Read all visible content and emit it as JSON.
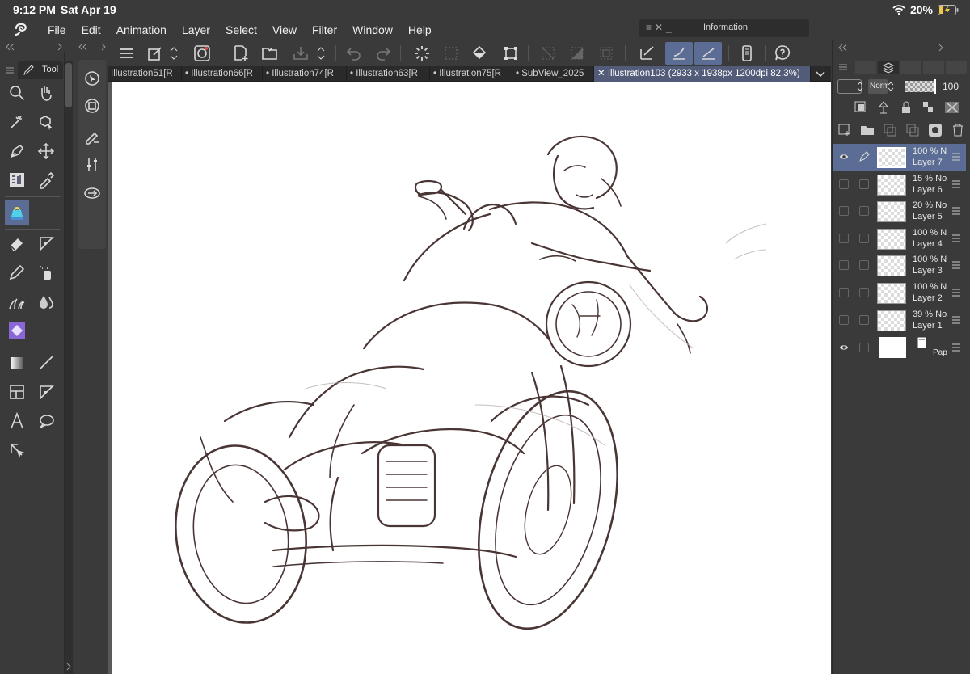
{
  "status": {
    "time": "9:12 PM",
    "date": "Sat Apr 19",
    "battery": "20%"
  },
  "menu": {
    "items": [
      "File",
      "Edit",
      "Animation",
      "Layer",
      "Select",
      "View",
      "Filter",
      "Window",
      "Help"
    ]
  },
  "info_panel": {
    "title": "Information"
  },
  "left_panel": {
    "tab_label": "Tool"
  },
  "tabs": [
    {
      "label": "Illustration51[R"
    },
    {
      "label": "Illustration66[R"
    },
    {
      "label": "Illustration74[R"
    },
    {
      "label": "Illustration63[R"
    },
    {
      "label": "Illustration75[R"
    },
    {
      "label": "SubView_2025"
    },
    {
      "label": "Illustration103 (2933 x 1938px 1200dpi 82.3%)"
    }
  ],
  "layer_panel": {
    "blend_mode": "Norm",
    "opacity": "100",
    "layers": [
      {
        "opacity": "100 %",
        "blend": "N",
        "name": "Layer 7",
        "visible": true,
        "selected": true
      },
      {
        "opacity": "15 %",
        "blend": "No",
        "name": "Layer 6",
        "visible": false,
        "selected": false
      },
      {
        "opacity": "20 %",
        "blend": "No",
        "name": "Layer 5",
        "visible": false,
        "selected": false
      },
      {
        "opacity": "100 %",
        "blend": "N",
        "name": "Layer 4",
        "visible": false,
        "selected": false
      },
      {
        "opacity": "100 %",
        "blend": "N",
        "name": "Layer 3",
        "visible": false,
        "selected": false
      },
      {
        "opacity": "100 %",
        "blend": "N",
        "name": "Layer 2",
        "visible": false,
        "selected": false
      },
      {
        "opacity": "39 %",
        "blend": "No",
        "name": "Layer 1",
        "visible": false,
        "selected": false
      }
    ],
    "paper": {
      "name": "Pap",
      "visible": true
    }
  },
  "colors": {
    "accent": "#5c6d95",
    "panel": "#3a3a3a",
    "sketch": "#4a3535"
  }
}
